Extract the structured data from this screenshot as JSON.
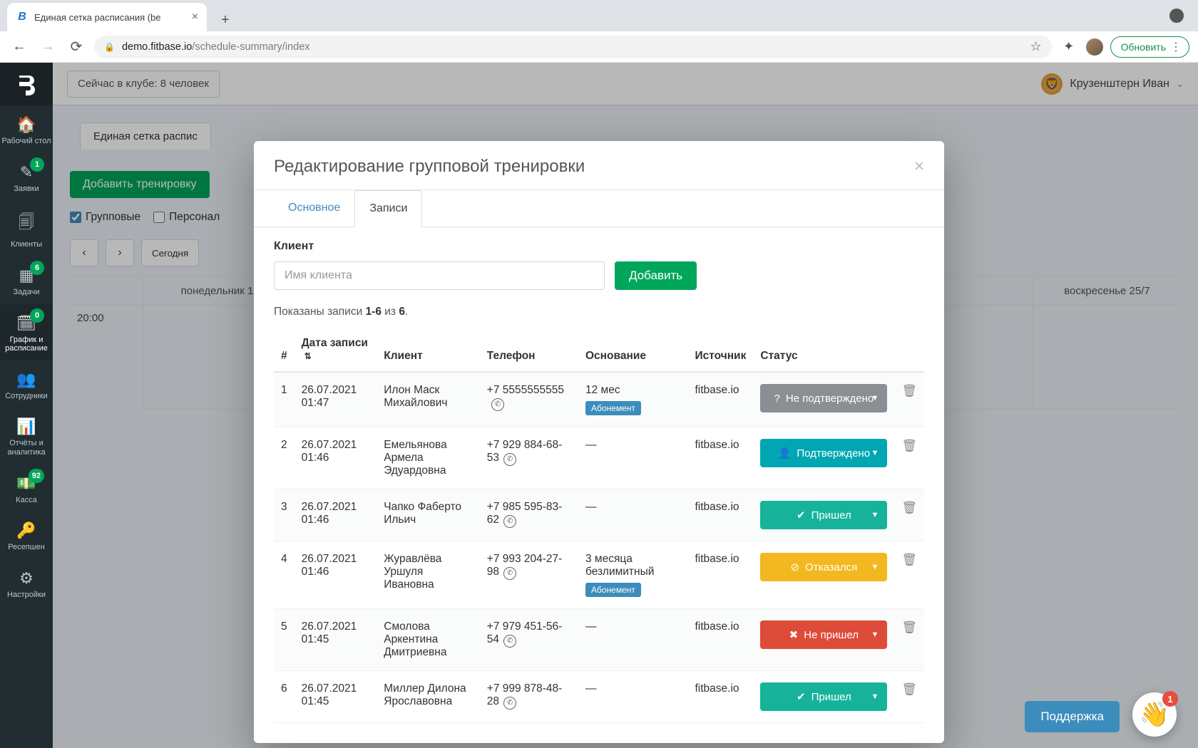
{
  "browser": {
    "tab_title": "Единая сетка расписания (be",
    "url_host": "demo.fitbase.io",
    "url_path": "/schedule-summary/index",
    "update_label": "Обновить"
  },
  "topbar": {
    "club_count": "Сейчас в клубе: 8 человек",
    "user_name": "Крузенштерн Иван"
  },
  "sidebar": {
    "items": [
      {
        "icon": "home",
        "label": "Рабочий стол"
      },
      {
        "icon": "pencil",
        "label": "Заявки",
        "badge": "1"
      },
      {
        "icon": "copy",
        "label": "Клиенты"
      },
      {
        "icon": "tasks",
        "label": "Задачи",
        "badge": "6"
      },
      {
        "icon": "calendar",
        "label": "График и расписание",
        "badge": "0",
        "active": true
      },
      {
        "icon": "users",
        "label": "Сотрудники"
      },
      {
        "icon": "chart",
        "label": "Отчёты и аналитика"
      },
      {
        "icon": "cash",
        "label": "Касса",
        "badge": "92"
      },
      {
        "icon": "key",
        "label": "Ресепшен"
      },
      {
        "icon": "gear",
        "label": "Настройки"
      }
    ]
  },
  "content": {
    "breadcrumb": "Единая сетка распис",
    "add_training": "Добавить тренировку",
    "filter_group": "Групповые",
    "filter_personal": "Персонал",
    "today": "Сегодня",
    "days": [
      "понедельник 1",
      "",
      "",
      "",
      "",
      "",
      "воскресенье 25/7"
    ],
    "hour": "20:00"
  },
  "modal": {
    "title": "Редактирование групповой тренировки",
    "tabs": {
      "main": "Основное",
      "records": "Записи"
    },
    "client_label": "Клиент",
    "client_placeholder": "Имя клиента",
    "add_btn": "Добавить",
    "summary_prefix": "Показаны записи ",
    "summary_range": "1-6",
    "summary_mid": " из ",
    "summary_total": "6",
    "columns": {
      "num": "#",
      "date": "Дата записи",
      "client": "Клиент",
      "phone": "Телефон",
      "basis": "Основание",
      "source": "Источник",
      "status": "Статус"
    },
    "sub_badge": "Абонемент",
    "rows": [
      {
        "n": "1",
        "date": "26.07.2021 01:47",
        "client": "Илон Маск Михайлович",
        "phone": "+7 5555555555",
        "basis": "12 мес",
        "sub": true,
        "source": "fitbase.io",
        "status": "Не подтверждено",
        "status_cls": "st-gray",
        "status_icon": "?"
      },
      {
        "n": "2",
        "date": "26.07.2021 01:46",
        "client": "Емельянова Армела Эдуардовна",
        "phone": "+7 929 884-68-53",
        "basis": "—",
        "sub": false,
        "source": "fitbase.io",
        "status": "Подтверждено",
        "status_cls": "st-teal",
        "status_icon": "user"
      },
      {
        "n": "3",
        "date": "26.07.2021 01:46",
        "client": "Чапко Фаберто Ильич",
        "phone": "+7 985 595-83-62",
        "basis": "—",
        "sub": false,
        "source": "fitbase.io",
        "status": "Пришел",
        "status_cls": "st-teal2",
        "status_icon": "check"
      },
      {
        "n": "4",
        "date": "26.07.2021 01:46",
        "client": "Журавлёва Уршуля Ивановна",
        "phone": "+7 993 204-27-98",
        "basis": "3 месяца безлимитный",
        "sub": true,
        "source": "fitbase.io",
        "status": "Отказался",
        "status_cls": "st-yellow",
        "status_icon": "ban"
      },
      {
        "n": "5",
        "date": "26.07.2021 01:45",
        "client": "Смолова Аркентина Дмитриевна",
        "phone": "+7 979 451-56-54",
        "basis": "—",
        "sub": false,
        "source": "fitbase.io",
        "status": "Не пришел",
        "status_cls": "st-red",
        "status_icon": "x"
      },
      {
        "n": "6",
        "date": "26.07.2021 01:45",
        "client": "Миллер Дилона Ярославовна",
        "phone": "+7 999 878-48-28",
        "basis": "—",
        "sub": false,
        "source": "fitbase.io",
        "status": "Пришел",
        "status_cls": "st-teal2",
        "status_icon": "check"
      }
    ]
  },
  "support_label": "Поддержка",
  "wave_badge": "1"
}
